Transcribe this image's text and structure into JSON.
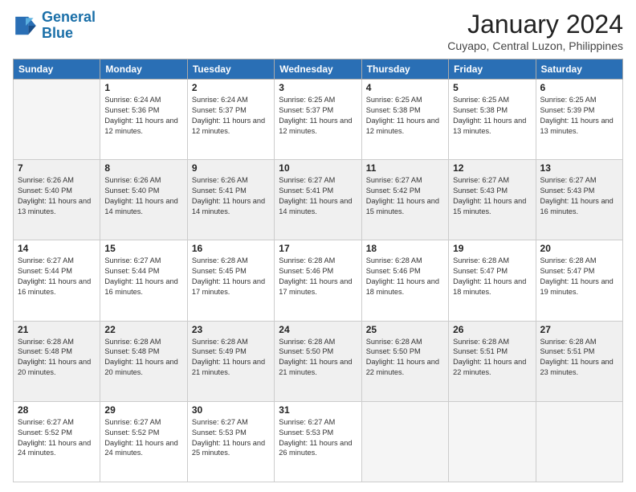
{
  "logo": {
    "line1": "General",
    "line2": "Blue"
  },
  "title": "January 2024",
  "subtitle": "Cuyapo, Central Luzon, Philippines",
  "days": [
    "Sunday",
    "Monday",
    "Tuesday",
    "Wednesday",
    "Thursday",
    "Friday",
    "Saturday"
  ],
  "weeks": [
    [
      {
        "num": "",
        "empty": true
      },
      {
        "num": "1",
        "sunrise": "6:24 AM",
        "sunset": "5:36 PM",
        "daylight": "11 hours and 12 minutes."
      },
      {
        "num": "2",
        "sunrise": "6:24 AM",
        "sunset": "5:37 PM",
        "daylight": "11 hours and 12 minutes."
      },
      {
        "num": "3",
        "sunrise": "6:25 AM",
        "sunset": "5:37 PM",
        "daylight": "11 hours and 12 minutes."
      },
      {
        "num": "4",
        "sunrise": "6:25 AM",
        "sunset": "5:38 PM",
        "daylight": "11 hours and 12 minutes."
      },
      {
        "num": "5",
        "sunrise": "6:25 AM",
        "sunset": "5:38 PM",
        "daylight": "11 hours and 13 minutes."
      },
      {
        "num": "6",
        "sunrise": "6:25 AM",
        "sunset": "5:39 PM",
        "daylight": "11 hours and 13 minutes."
      }
    ],
    [
      {
        "num": "7",
        "sunrise": "6:26 AM",
        "sunset": "5:40 PM",
        "daylight": "11 hours and 13 minutes."
      },
      {
        "num": "8",
        "sunrise": "6:26 AM",
        "sunset": "5:40 PM",
        "daylight": "11 hours and 14 minutes."
      },
      {
        "num": "9",
        "sunrise": "6:26 AM",
        "sunset": "5:41 PM",
        "daylight": "11 hours and 14 minutes."
      },
      {
        "num": "10",
        "sunrise": "6:27 AM",
        "sunset": "5:41 PM",
        "daylight": "11 hours and 14 minutes."
      },
      {
        "num": "11",
        "sunrise": "6:27 AM",
        "sunset": "5:42 PM",
        "daylight": "11 hours and 15 minutes."
      },
      {
        "num": "12",
        "sunrise": "6:27 AM",
        "sunset": "5:43 PM",
        "daylight": "11 hours and 15 minutes."
      },
      {
        "num": "13",
        "sunrise": "6:27 AM",
        "sunset": "5:43 PM",
        "daylight": "11 hours and 16 minutes."
      }
    ],
    [
      {
        "num": "14",
        "sunrise": "6:27 AM",
        "sunset": "5:44 PM",
        "daylight": "11 hours and 16 minutes."
      },
      {
        "num": "15",
        "sunrise": "6:27 AM",
        "sunset": "5:44 PM",
        "daylight": "11 hours and 16 minutes."
      },
      {
        "num": "16",
        "sunrise": "6:28 AM",
        "sunset": "5:45 PM",
        "daylight": "11 hours and 17 minutes."
      },
      {
        "num": "17",
        "sunrise": "6:28 AM",
        "sunset": "5:46 PM",
        "daylight": "11 hours and 17 minutes."
      },
      {
        "num": "18",
        "sunrise": "6:28 AM",
        "sunset": "5:46 PM",
        "daylight": "11 hours and 18 minutes."
      },
      {
        "num": "19",
        "sunrise": "6:28 AM",
        "sunset": "5:47 PM",
        "daylight": "11 hours and 18 minutes."
      },
      {
        "num": "20",
        "sunrise": "6:28 AM",
        "sunset": "5:47 PM",
        "daylight": "11 hours and 19 minutes."
      }
    ],
    [
      {
        "num": "21",
        "sunrise": "6:28 AM",
        "sunset": "5:48 PM",
        "daylight": "11 hours and 20 minutes."
      },
      {
        "num": "22",
        "sunrise": "6:28 AM",
        "sunset": "5:48 PM",
        "daylight": "11 hours and 20 minutes."
      },
      {
        "num": "23",
        "sunrise": "6:28 AM",
        "sunset": "5:49 PM",
        "daylight": "11 hours and 21 minutes."
      },
      {
        "num": "24",
        "sunrise": "6:28 AM",
        "sunset": "5:50 PM",
        "daylight": "11 hours and 21 minutes."
      },
      {
        "num": "25",
        "sunrise": "6:28 AM",
        "sunset": "5:50 PM",
        "daylight": "11 hours and 22 minutes."
      },
      {
        "num": "26",
        "sunrise": "6:28 AM",
        "sunset": "5:51 PM",
        "daylight": "11 hours and 22 minutes."
      },
      {
        "num": "27",
        "sunrise": "6:28 AM",
        "sunset": "5:51 PM",
        "daylight": "11 hours and 23 minutes."
      }
    ],
    [
      {
        "num": "28",
        "sunrise": "6:27 AM",
        "sunset": "5:52 PM",
        "daylight": "11 hours and 24 minutes."
      },
      {
        "num": "29",
        "sunrise": "6:27 AM",
        "sunset": "5:52 PM",
        "daylight": "11 hours and 24 minutes."
      },
      {
        "num": "30",
        "sunrise": "6:27 AM",
        "sunset": "5:53 PM",
        "daylight": "11 hours and 25 minutes."
      },
      {
        "num": "31",
        "sunrise": "6:27 AM",
        "sunset": "5:53 PM",
        "daylight": "11 hours and 26 minutes."
      },
      {
        "num": "",
        "empty": true
      },
      {
        "num": "",
        "empty": true
      },
      {
        "num": "",
        "empty": true
      }
    ]
  ]
}
